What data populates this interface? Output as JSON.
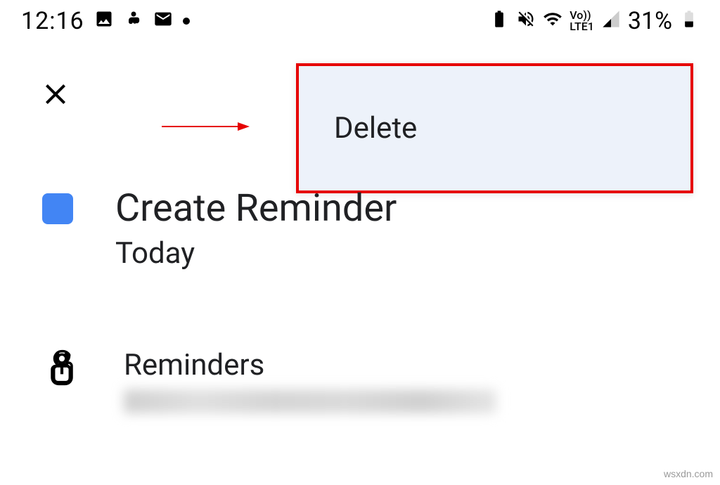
{
  "status_bar": {
    "time": "12:16",
    "battery_percent": "31%",
    "network_label": "Vo))\nLTE1"
  },
  "toolbar": {
    "close_icon": "close"
  },
  "menu": {
    "delete_label": "Delete"
  },
  "reminder": {
    "title": "Create Reminder",
    "date": "Today",
    "account_label": "Reminders"
  },
  "watermark": "wsxdn.com"
}
